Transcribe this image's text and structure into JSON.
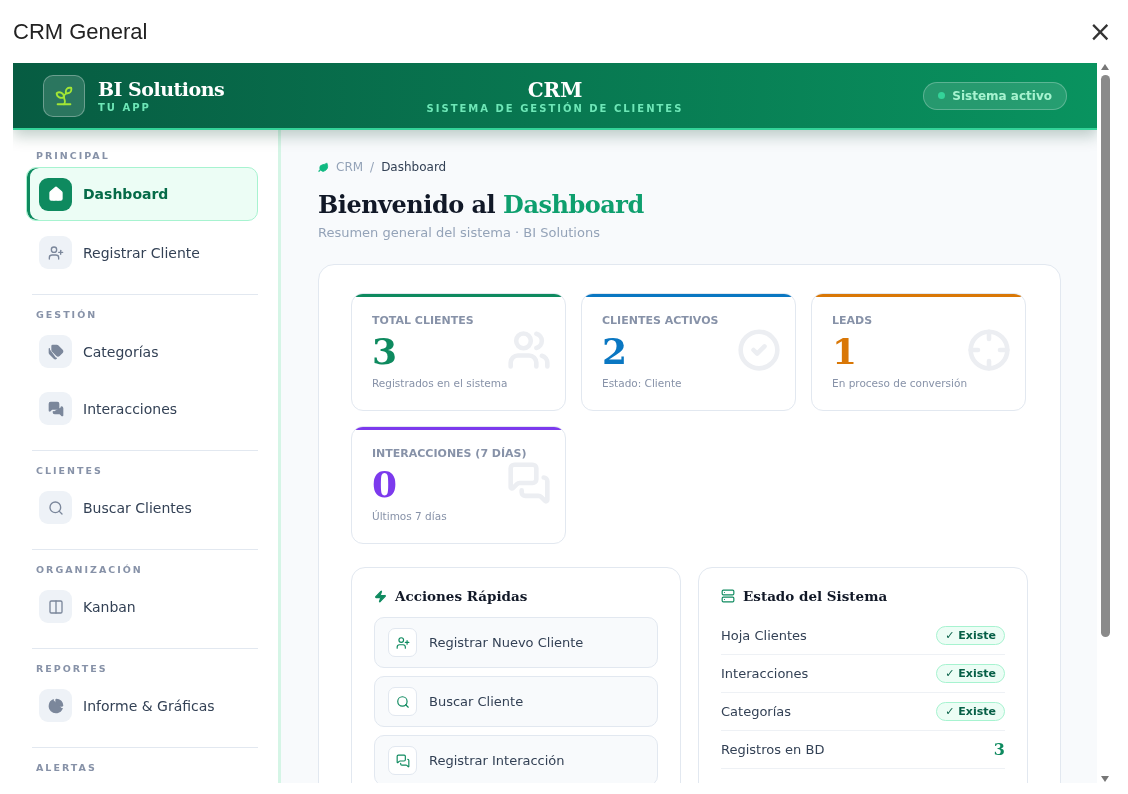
{
  "window": {
    "title": "CRM General",
    "close": "×"
  },
  "header": {
    "brand": "BI Solutions",
    "brand_sub": "TU APP",
    "title": "CRM",
    "subtitle": "SISTEMA DE GESTIÓN DE CLIENTES",
    "status": "Sistema activo"
  },
  "sidebar": {
    "sections": [
      {
        "label": "PRINCIPAL",
        "items": [
          {
            "label": "Dashboard",
            "selected": true
          },
          {
            "label": "Registrar Cliente",
            "selected": false
          }
        ]
      },
      {
        "label": "GESTIÓN",
        "items": [
          {
            "label": "Categorías",
            "selected": false
          },
          {
            "label": "Interacciones",
            "selected": false
          }
        ]
      },
      {
        "label": "CLIENTES",
        "items": [
          {
            "label": "Buscar Clientes",
            "selected": false
          }
        ]
      },
      {
        "label": "ORGANIZACIÓN",
        "items": [
          {
            "label": "Kanban",
            "selected": false
          }
        ]
      },
      {
        "label": "REPORTES",
        "items": [
          {
            "label": "Informe & Gráficas",
            "selected": false
          }
        ]
      },
      {
        "label": "ALERTAS"
      }
    ]
  },
  "breadcrumb": {
    "separator": "/",
    "items": [
      "CRM",
      "Dashboard"
    ]
  },
  "heading": {
    "lead": "Bienvenido al",
    "accent": "Dashboard",
    "subtitle": "Resumen general del sistema · BI Solutions"
  },
  "stats": [
    {
      "label": "TOTAL CLIENTES",
      "value": "3",
      "note": "Registrados en el sistema",
      "color": "#0e8a5f"
    },
    {
      "label": "CLIENTES ACTIVOS",
      "value": "2",
      "note": "Estado: Cliente",
      "color": "#0a77c2"
    },
    {
      "label": "LEADS",
      "value": "1",
      "note": "En proceso de conversión",
      "color": "#d97706"
    },
    {
      "label": "INTERACCIONES (7 DÍAS)",
      "value": "0",
      "note": "Últimos 7 días",
      "color": "#7c3aed"
    }
  ],
  "quick_actions": {
    "title": "Acciones Rápidas",
    "items": [
      "Registrar Nuevo Cliente",
      "Buscar Cliente",
      "Registrar Interacción"
    ]
  },
  "system_status": {
    "title": "Estado del Sistema",
    "rows": [
      {
        "label": "Hoja Clientes",
        "kind": "badge",
        "value": "✓ Existe"
      },
      {
        "label": "Interacciones",
        "kind": "badge",
        "value": "✓ Existe"
      },
      {
        "label": "Categorías",
        "kind": "badge",
        "value": "✓ Existe"
      },
      {
        "label": "Registros en BD",
        "kind": "count",
        "value": "3"
      }
    ]
  }
}
